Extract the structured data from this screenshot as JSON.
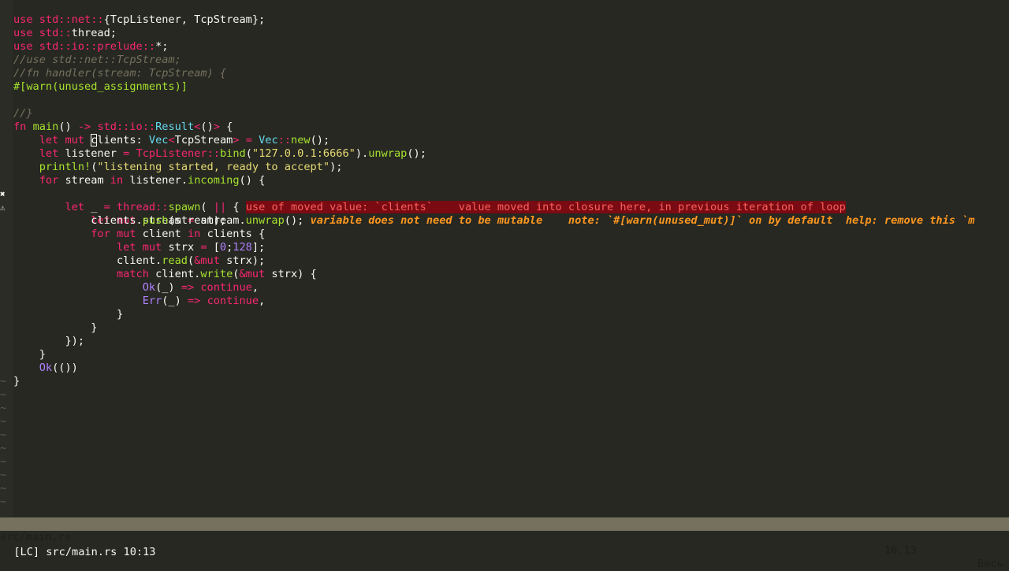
{
  "editor": {
    "signs": {
      "error_sign": "✖",
      "warning_sign": "⚠"
    },
    "lines": {
      "l1": {
        "kw": "use ",
        "ns": "std::net::",
        "rest": "{TcpListener, TcpStream};"
      },
      "l2": {
        "kw": "use ",
        "ns": "std::",
        "rest": "thread;"
      },
      "l3": {
        "kw": "use ",
        "ns": "std::io::prelude::",
        "rest": "*;"
      },
      "l4": {
        "comment": "//use std::net::TcpStream;"
      },
      "l5": {
        "comment": "//fn handler(stream: TcpStream) {"
      },
      "l6": {
        "attr": "#[warn(unused_assignments)]"
      },
      "l7": {
        "comment": "//}"
      },
      "l8": {
        "fnkw": "fn ",
        "fname": "main",
        "p1": "() ",
        "arrow": "-> ",
        "ns": "std::io::",
        "ty": "Result",
        "lt": "<",
        "p2": "()",
        "gt": ">",
        "p3": " {"
      },
      "l9": {
        "indent": "    ",
        "kw": "let mut ",
        "cur": "c",
        "rest1": "lients: ",
        "ty1": "Vec",
        "lt": "<",
        "ty2": "TcpStream",
        "gt": ">",
        "eq": " = ",
        "ty3": "Vec",
        "ns": "::",
        "fn": "new",
        "rest2": "();"
      },
      "l10": {
        "indent": "    ",
        "kw": "let ",
        "rest1": "listener ",
        "eq": "= ",
        "ty": "TcpListener",
        "ns": "::",
        "fn": "bind",
        "p1": "(",
        "st": "\"127.0.0.1:6666\"",
        "p2": ").",
        "fn2": "unwrap",
        "p3": "();"
      },
      "l11": {
        "indent": "    ",
        "fn": "println!",
        "p1": "(",
        "st": "\"listening started, ready to accept\"",
        "p2": ");"
      },
      "l12": {
        "indent": "    ",
        "kw": "for ",
        "rest1": "stream ",
        "kw2": "in ",
        "rest2": "listener.",
        "fn": "incoming",
        "p": "() {"
      },
      "l13": {
        "indent": "        ",
        "kw": "let ",
        "rest1": "_ ",
        "eq": "= ",
        "ns": "thread::",
        "fn": "spawn",
        "p1": "( ",
        "pipes": "||",
        "p2": " { ",
        "vt": "use of moved value: `clients`    value moved into closure here, in previous iteration of loop"
      },
      "l14": {
        "indent": "            ",
        "kw": "let mut ",
        "rest1": "stream ",
        "eq": "= ",
        "rest2": "stream.",
        "fn": "unwrap",
        "p": "(); ",
        "vt": "variable does not need to be mutable    note: `#[warn(unused_mut)]` on by default  help: remove this `m"
      },
      "l15": {
        "indent": "            ",
        "rest1": "clients.",
        "fn": "push",
        "p": "(stream);"
      },
      "l16": {
        "indent": "            ",
        "kw": "for mut ",
        "rest1": "client ",
        "kw2": "in ",
        "rest2": "clients {"
      },
      "l17": {
        "indent": "                ",
        "kw": "let mut ",
        "rest1": "strx ",
        "eq": "= ",
        "p1": "[",
        "n1": "0",
        "p2": ";",
        "n2": "128",
        "p3": "];"
      },
      "l18": {
        "indent": "                ",
        "rest1": "client.",
        "fn": "read",
        "p1": "(",
        "amp": "&mut ",
        "p2": "strx);"
      },
      "l19": {
        "indent": "                ",
        "kw": "match ",
        "rest1": "client.",
        "fn": "write",
        "p1": "(",
        "amp": "&mut ",
        "p2": "strx) {"
      },
      "l20": {
        "indent": "                    ",
        "ok": "Ok",
        "p1": "(_) ",
        "arrow": "=> ",
        "kw": "continue",
        "p2": ","
      },
      "l21": {
        "indent": "                    ",
        "err": "Err",
        "p1": "(_) ",
        "arrow": "=> ",
        "kw": "continue",
        "p2": ","
      },
      "l22": {
        "text": "                }"
      },
      "l23": {
        "text": "            }"
      },
      "l24": {
        "text": "        });"
      },
      "l25": {
        "text": "    }"
      },
      "l26": {
        "indent": "    ",
        "ok": "Ok",
        "p": "(())"
      },
      "l27": {
        "text": "}"
      }
    },
    "tilde": "~"
  },
  "statusline": {
    "filename": "src/main.rs",
    "position": "10,13",
    "percent": "Весь"
  },
  "cmdline": {
    "text": "[LC] src/main.rs 10:13"
  },
  "colors": {
    "background": "#272822",
    "keyword": "#f92672",
    "type": "#66d9ef",
    "function": "#a6e22e",
    "string": "#e6db74",
    "number": "#ae81ff",
    "comment": "#75715e",
    "error_bg": "#7a0b12",
    "error_fg": "#ff5f5f",
    "warning_fg": "#fd971f",
    "statusline_bg": "#75715e"
  }
}
